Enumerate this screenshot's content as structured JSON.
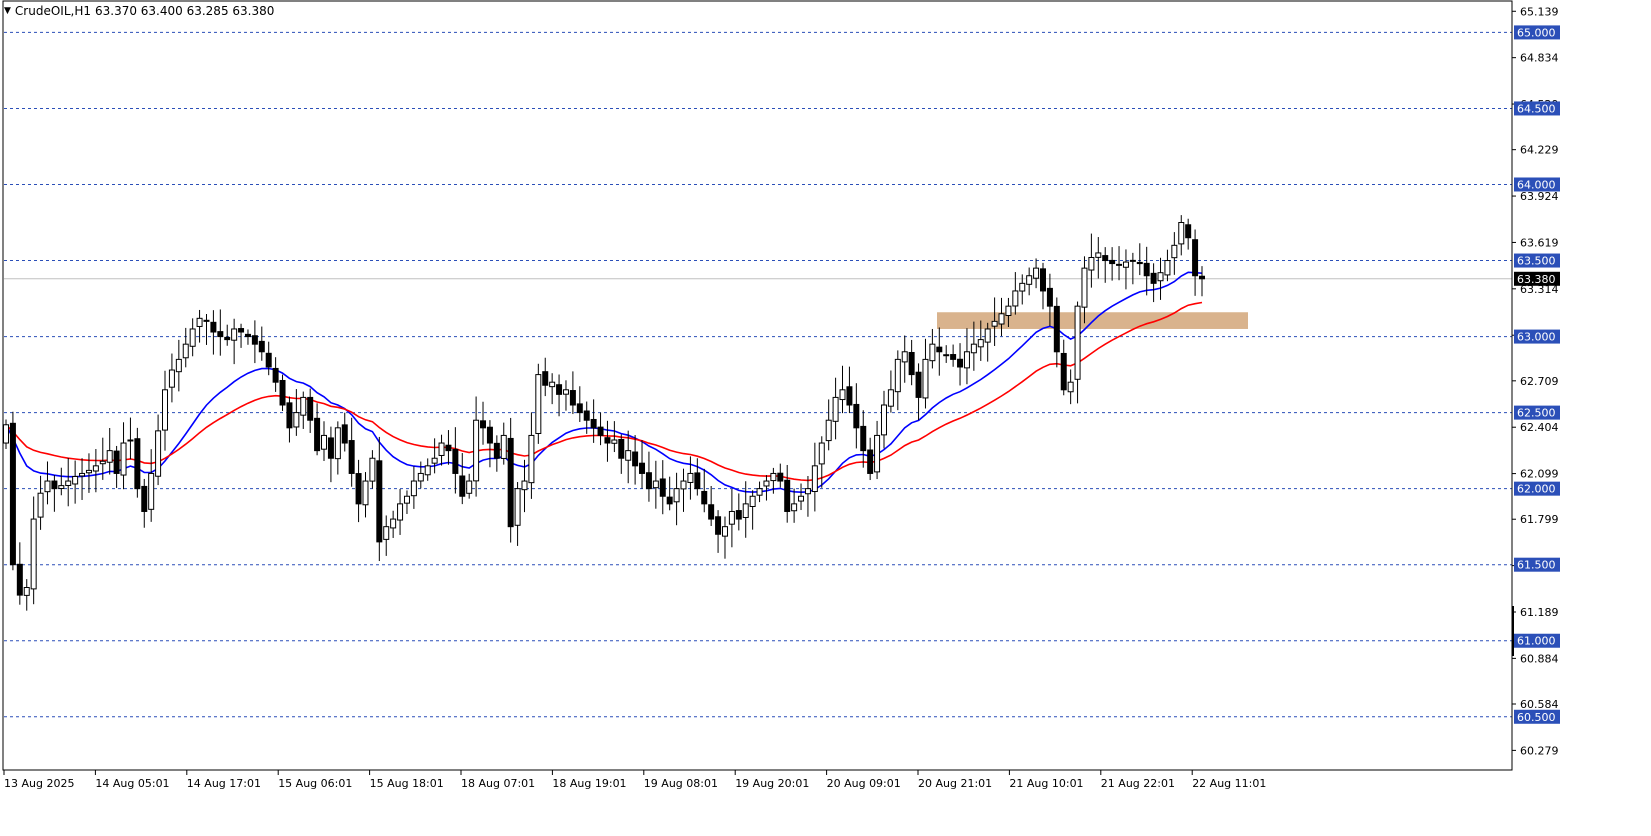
{
  "header": {
    "symbol": "CrudeOIL,H1",
    "ohlc": "63.370 63.400 63.285 63.380",
    "arrow": "▼"
  },
  "colors": {
    "background": "#ffffff",
    "grid_line": "#2b4fb8",
    "price_line": "#c0c0c0",
    "ema_fast": "#0000ff",
    "ema_slow": "#ff0000",
    "zone": "#d2a679",
    "candle_bull": "#ffffff",
    "candle_bear": "#000000",
    "level_label_bg": "#2b4fb8",
    "current_label_bg": "#000000"
  },
  "chart_data": {
    "type": "candlestick",
    "symbol": "CrudeOIL",
    "timeframe": "H1",
    "ylim": [
      60.15,
      65.2
    ],
    "y_ticks": [
      "65.139",
      "64.834",
      "64.529",
      "64.229",
      "63.924",
      "63.619",
      "63.314",
      "63.009",
      "62.709",
      "62.404",
      "62.099",
      "61.799",
      "61.494",
      "61.189",
      "60.884",
      "60.584",
      "60.279"
    ],
    "x_ticks": [
      "13 Aug 2025",
      "14 Aug 05:01",
      "14 Aug 17:01",
      "15 Aug 06:01",
      "15 Aug 18:01",
      "18 Aug 07:01",
      "18 Aug 19:01",
      "19 Aug 08:01",
      "19 Aug 20:01",
      "20 Aug 09:01",
      "20 Aug 21:01",
      "21 Aug 10:01",
      "21 Aug 22:01",
      "22 Aug 11:01"
    ],
    "horizontal_levels": [
      "65.000",
      "64.500",
      "64.000",
      "63.500",
      "63.000",
      "62.500",
      "62.000",
      "61.500",
      "61.000",
      "60.500"
    ],
    "current_price": "63.380",
    "zone": {
      "low": 63.05,
      "high": 63.16
    },
    "closes": [
      62.42,
      61.5,
      61.3,
      61.35,
      61.8,
      61.97,
      62.05,
      62.0,
      62.02,
      62.05,
      62.08,
      62.1,
      62.12,
      62.15,
      62.18,
      62.25,
      62.1,
      62.3,
      62.32,
      62.0,
      61.85,
      62.1,
      62.38,
      62.65,
      62.78,
      62.85,
      62.95,
      63.05,
      63.12,
      63.1,
      63.03,
      63.0,
      62.98,
      63.05,
      63.03,
      63.0,
      62.95,
      62.9,
      62.8,
      62.7,
      62.55,
      62.4,
      62.5,
      62.6,
      62.45,
      62.25,
      62.35,
      62.2,
      62.4,
      62.3,
      62.1,
      61.9,
      62.05,
      62.2,
      61.65,
      61.75,
      61.8,
      61.9,
      61.95,
      62.05,
      62.1,
      62.15,
      62.2,
      62.3,
      62.25,
      62.1,
      61.95,
      62.05,
      62.45,
      62.4,
      62.3,
      62.2,
      62.35,
      61.75,
      62.0,
      62.05,
      62.35,
      62.75,
      62.68,
      62.7,
      62.62,
      62.65,
      62.55,
      62.5,
      62.45,
      62.4,
      62.35,
      62.3,
      62.32,
      62.2,
      62.25,
      62.15,
      62.1,
      62.0,
      62.05,
      61.95,
      61.9,
      62.0,
      62.05,
      62.1,
      62.0,
      61.9,
      61.8,
      61.7,
      61.75,
      61.85,
      61.8,
      61.9,
      61.95,
      62.0,
      62.05,
      62.1,
      62.05,
      61.85,
      61.9,
      61.95,
      62.0,
      62.15,
      62.3,
      62.45,
      62.6,
      62.65,
      62.55,
      62.4,
      62.25,
      62.1,
      62.35,
      62.55,
      62.65,
      62.85,
      62.9,
      62.75,
      62.6,
      62.85,
      62.95,
      62.9,
      62.88,
      62.85,
      62.8,
      62.9,
      62.95,
      62.98,
      63.05,
      63.1,
      63.15,
      63.2,
      63.3,
      63.35,
      63.4,
      63.45,
      63.3,
      63.2,
      62.9,
      62.65,
      62.7,
      63.2,
      63.45,
      63.52,
      63.55,
      63.5,
      63.48,
      63.47,
      63.49,
      63.5,
      63.48,
      63.4,
      63.35,
      63.42,
      63.5,
      63.6,
      63.75,
      63.65,
      63.4,
      63.38
    ]
  }
}
